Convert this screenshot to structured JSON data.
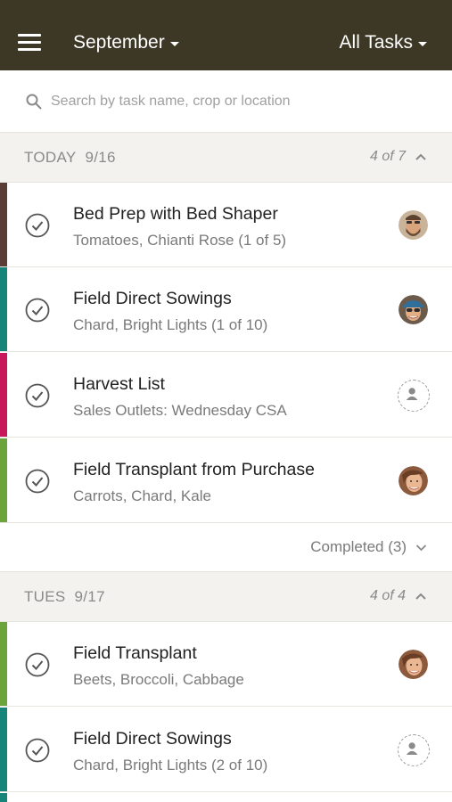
{
  "header": {
    "month_label": "September",
    "filter_label": "All Tasks"
  },
  "search": {
    "placeholder": "Search by task name, crop or location"
  },
  "sections": [
    {
      "day": "TODAY",
      "date": "9/16",
      "count": "4 of 7",
      "completed_label": "Completed (3)",
      "tasks": [
        {
          "title": "Bed Prep with Bed Shaper",
          "subtitle": "Tomatoes, Chianti Rose (1 of 5)",
          "stripe_color": "#5a3e36",
          "assignee": "man-with-beard"
        },
        {
          "title": "Field Direct Sowings",
          "subtitle": "Chard, Bright Lights (1 of 10)",
          "stripe_color": "#15857a",
          "assignee": "woman-with-cap"
        },
        {
          "title": "Harvest List",
          "subtitle": "Sales Outlets: Wednesday CSA",
          "stripe_color": "#c8175b",
          "assignee": "unassigned"
        },
        {
          "title": "Field Transplant from Purchase",
          "subtitle": "Carrots, Chard, Kale",
          "stripe_color": "#6ba43a",
          "assignee": "woman-smiling"
        }
      ]
    },
    {
      "day": "TUES",
      "date": "9/17",
      "count": "4 of 4",
      "tasks": [
        {
          "title": "Field Transplant",
          "subtitle": "Beets, Broccoli, Cabbage",
          "stripe_color": "#6ba43a",
          "assignee": "woman-smiling"
        },
        {
          "title": "Field Direct Sowings",
          "subtitle": "Chard, Bright Lights (2 of 10)",
          "stripe_color": "#15857a",
          "assignee": "unassigned"
        }
      ]
    }
  ]
}
